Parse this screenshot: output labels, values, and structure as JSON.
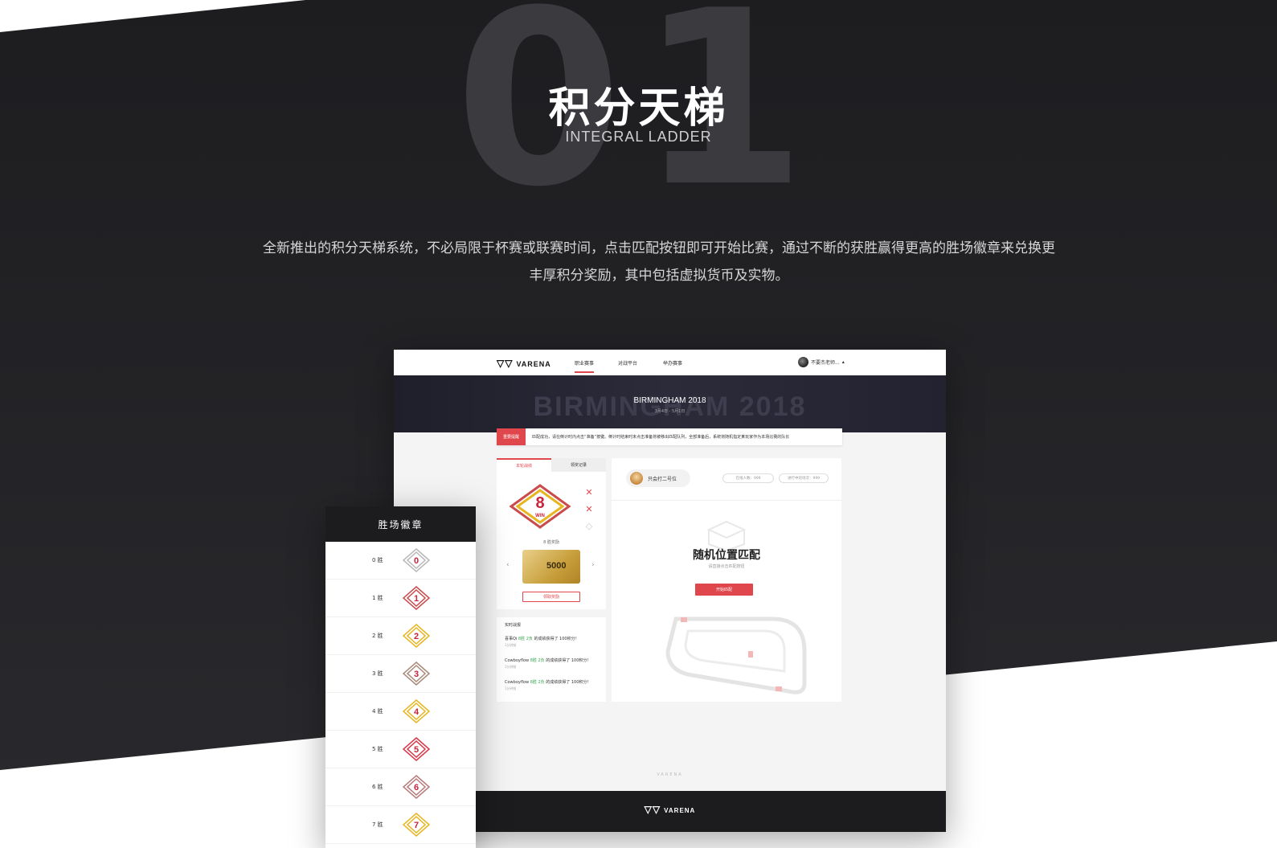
{
  "hero": {
    "number": "01",
    "title": "积分天梯",
    "subtitle": "INTEGRAL LADDER",
    "desc_line1": "全新推出的积分天梯系统，不必局限于杯赛或联赛时间，点击匹配按钮即可开始比赛，通过不断的获胜赢得更高的胜场徽章来兑换更",
    "desc_line2": "丰厚积分奖励，其中包括虚拟货币及实物。"
  },
  "mock": {
    "logo_text": "VARENA",
    "nav": [
      {
        "label": "职业赛事"
      },
      {
        "label": "对战平台"
      },
      {
        "label": "举办赛事"
      }
    ],
    "user_name": "不要杰老师...",
    "banner": {
      "big_text": "BIRMINGHAM 2018",
      "title": "BIRMINGHAM 2018",
      "date": "3月4日 - 5月1日"
    },
    "notice": {
      "tag": "重要提醒",
      "text": "匹配成功，请在倒计时内点击“准备”按键。倒计时结束时未点击准备将被移出匹配队列，全部准备后，系统将随机指定某玩家作为本场比赛的队长"
    },
    "left_panel": {
      "tabs": [
        {
          "label": "本轮战绩"
        },
        {
          "label": "领奖记录"
        }
      ],
      "current_wins": "8",
      "win_word": "WIN",
      "reward_label": "8 胜奖励",
      "reward_amount": "5000",
      "claim_label": "领取奖励"
    },
    "feed": {
      "title": "实时战报",
      "items": [
        {
          "user": "喜事Qi",
          "record": "8胜 2负",
          "text": "的成绩获得了 100积分！",
          "time": "1分钟前"
        },
        {
          "user": "Cowboyflow",
          "record": "8胜 2负",
          "text": "的成绩获得了 100积分！",
          "time": "1分钟前"
        },
        {
          "user": "Cowboyflow",
          "record": "8胜 2负",
          "text": "的成绩获得了 100积分！",
          "time": "1分钟前"
        }
      ]
    },
    "right_panel": {
      "player_name": "只会打二号位",
      "online_label": "在线人数：999",
      "matching_label": "进行中的场次：999",
      "match_title": "随机位置匹配",
      "match_sub": "请直接点击匹配按钮",
      "match_button": "开始匹配"
    },
    "footer_mark": "VARENA",
    "footer_logo": "VARENA"
  },
  "side_panel": {
    "title": "胜场徽章",
    "rows": [
      {
        "label": "0 胜",
        "num": "0",
        "color": "#b8b8b8"
      },
      {
        "label": "1 胜",
        "num": "1",
        "color": "#c94b4b"
      },
      {
        "label": "2 胜",
        "num": "2",
        "color": "#e7b520"
      },
      {
        "label": "3 胜",
        "num": "3",
        "color": "#a98a7a"
      },
      {
        "label": "4 胜",
        "num": "4",
        "color": "#e7b520"
      },
      {
        "label": "5 胜",
        "num": "5",
        "color": "#d8374a"
      },
      {
        "label": "6 胜",
        "num": "6",
        "color": "#b87a7a"
      },
      {
        "label": "7 胜",
        "num": "7",
        "color": "#e7b520"
      }
    ]
  },
  "colors": {
    "accent": "#e0474c",
    "dark_bg": "#232326",
    "gold": "#c89f3c"
  }
}
